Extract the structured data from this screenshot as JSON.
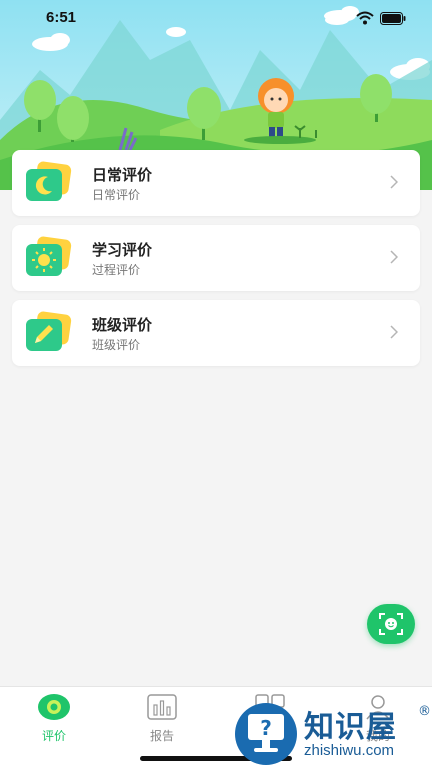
{
  "status_bar": {
    "time": "6:51"
  },
  "cards": [
    {
      "title": "日常评价",
      "subtitle": "日常评价",
      "icon": "moon-icon"
    },
    {
      "title": "学习评价",
      "subtitle": "过程评价",
      "icon": "sun-icon"
    },
    {
      "title": "班级评价",
      "subtitle": "班级评价",
      "icon": "pencil-icon"
    }
  ],
  "tabs": [
    {
      "label": "评价",
      "icon": "evaluation-icon",
      "active": true
    },
    {
      "label": "报告",
      "icon": "report-chart-icon",
      "active": false
    },
    {
      "label": "",
      "icon": "grid-icon",
      "active": false
    },
    {
      "label": "我的",
      "icon": "profile-icon",
      "active": false
    }
  ],
  "watermark": {
    "brand": "知识屋",
    "domain": "zhishiwu.com",
    "mark": "®"
  },
  "colors": {
    "accent": "#1fc46a",
    "card_icon_bg": "#2ec98a",
    "card_icon_back": "#ffd23f",
    "watermark": "#1a5c96"
  }
}
